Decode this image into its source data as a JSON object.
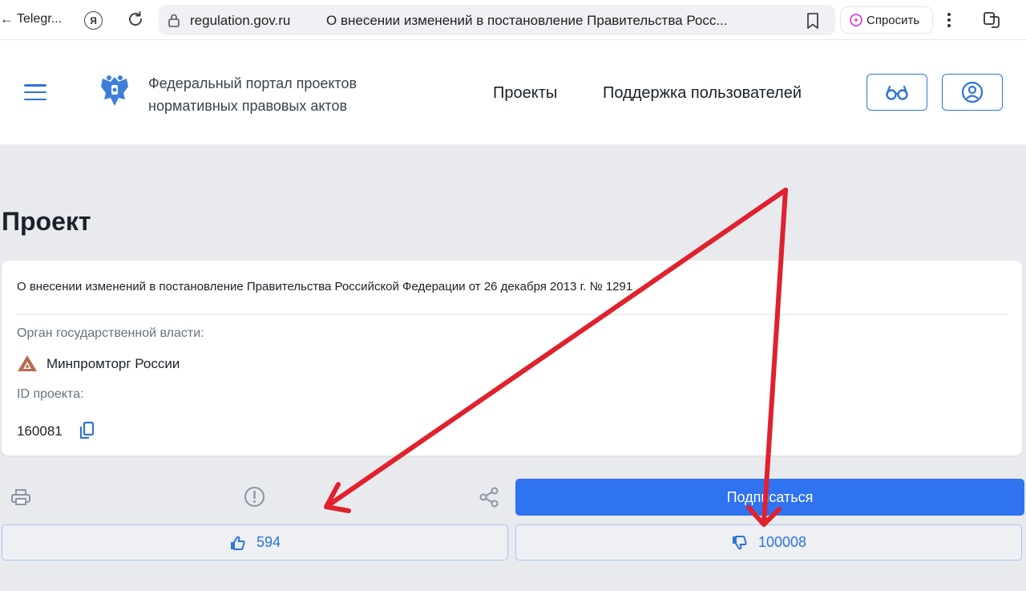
{
  "browser": {
    "back_tab_label": "Telegr...",
    "yandex_label": "Я",
    "url_domain": "regulation.gov.ru",
    "page_title": "О внесении изменений в постановление Правительства Росс...",
    "ask_label": "Спросить"
  },
  "header": {
    "portal_name_line1": "Федеральный портал проектов",
    "portal_name_line2": "нормативных правовых актов",
    "nav": {
      "projects": "Проекты",
      "support": "Поддержка пользователей"
    }
  },
  "main": {
    "title": "Проект",
    "card": {
      "doc_title": "О внесении изменений в постановление Правительства Российской Федерации от 26 декабря 2013 г. № 1291",
      "authority_label": "Орган государственной власти:",
      "authority_name": "Минпромторг России",
      "id_label": "ID проекта:",
      "id_value": "160081"
    },
    "actions": {
      "subscribe_label": "Подписаться",
      "likes": "594",
      "dislikes": "100008"
    }
  },
  "colors": {
    "accent": "#2f73f0",
    "link_blue": "#2f73d8",
    "annotation_red": "#e0212e",
    "authority_logo": "#b86a4f"
  },
  "icons": [
    "back-arrow-icon",
    "yandex-icon",
    "reload-icon",
    "lock-icon",
    "bookmark-icon",
    "alice-icon",
    "more-icon",
    "extension-icon",
    "menu-icon",
    "emblem-icon",
    "vision-icon",
    "user-icon",
    "copy-icon",
    "print-icon",
    "warning-icon",
    "share-icon",
    "thumbs-up-icon",
    "thumbs-down-icon"
  ]
}
